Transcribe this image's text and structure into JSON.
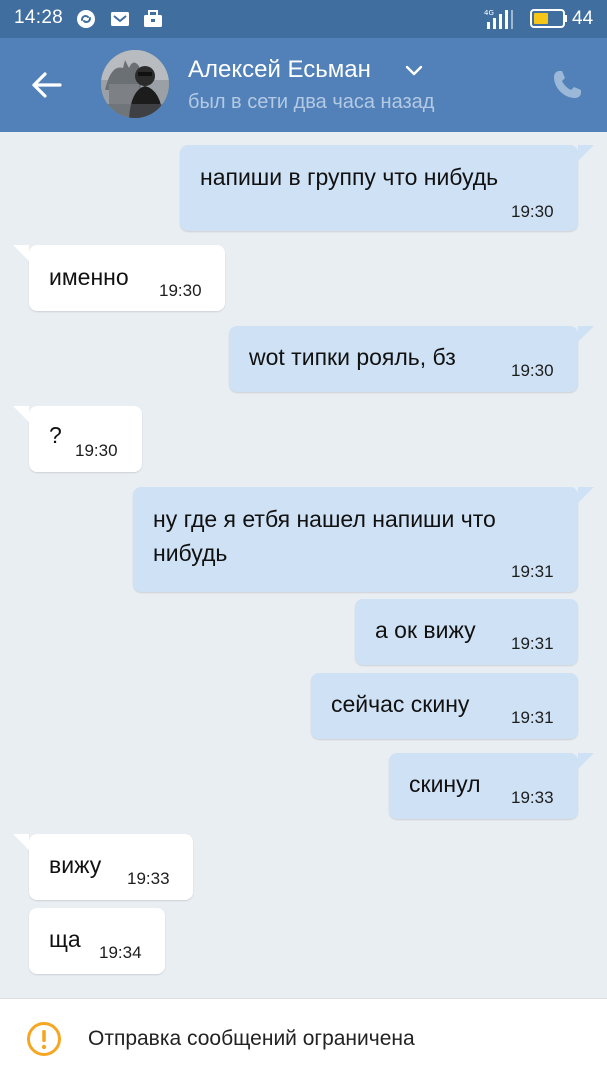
{
  "status_bar": {
    "time": "14:28",
    "battery": "44",
    "network": "4G",
    "icons": [
      "shazam-icon",
      "mail-icon",
      "briefcase-icon"
    ]
  },
  "header": {
    "contact_name": "Алексей Есьман",
    "contact_status": "был в сети два часа назад",
    "back_icon": "arrow-left-icon",
    "call_icon": "phone-icon"
  },
  "messages": [
    {
      "direction": "out",
      "text": "напиши в группу что нибудь",
      "time": "19:30"
    },
    {
      "direction": "in",
      "text": "именно",
      "time": "19:30"
    },
    {
      "direction": "out",
      "text": "wot типки рояль, бз",
      "time": "19:30"
    },
    {
      "direction": "in",
      "text": "?",
      "time": "19:30"
    },
    {
      "direction": "out",
      "text_line1": "ну где я етбя нашел напиши что",
      "text_line2": "нибудь",
      "time": "19:31"
    },
    {
      "direction": "out",
      "text": "а ок вижу",
      "time": "19:31"
    },
    {
      "direction": "out",
      "text": "сейчас скину",
      "time": "19:31"
    },
    {
      "direction": "out",
      "text": "скинул",
      "time": "19:33"
    },
    {
      "direction": "in",
      "text": "вижу",
      "time": "19:33"
    },
    {
      "direction": "in",
      "text": "ща",
      "time": "19:34"
    }
  ],
  "footer": {
    "notice": "Отправка сообщений ограничена",
    "icon": "warning-icon"
  },
  "colors": {
    "status_bar": "#3f6e9f",
    "header": "#5181b8",
    "chat_background": "#e9eef3",
    "outgoing_bubble": "#cfe1f4",
    "incoming_bubble": "#ffffff",
    "warning": "#f5a623"
  }
}
